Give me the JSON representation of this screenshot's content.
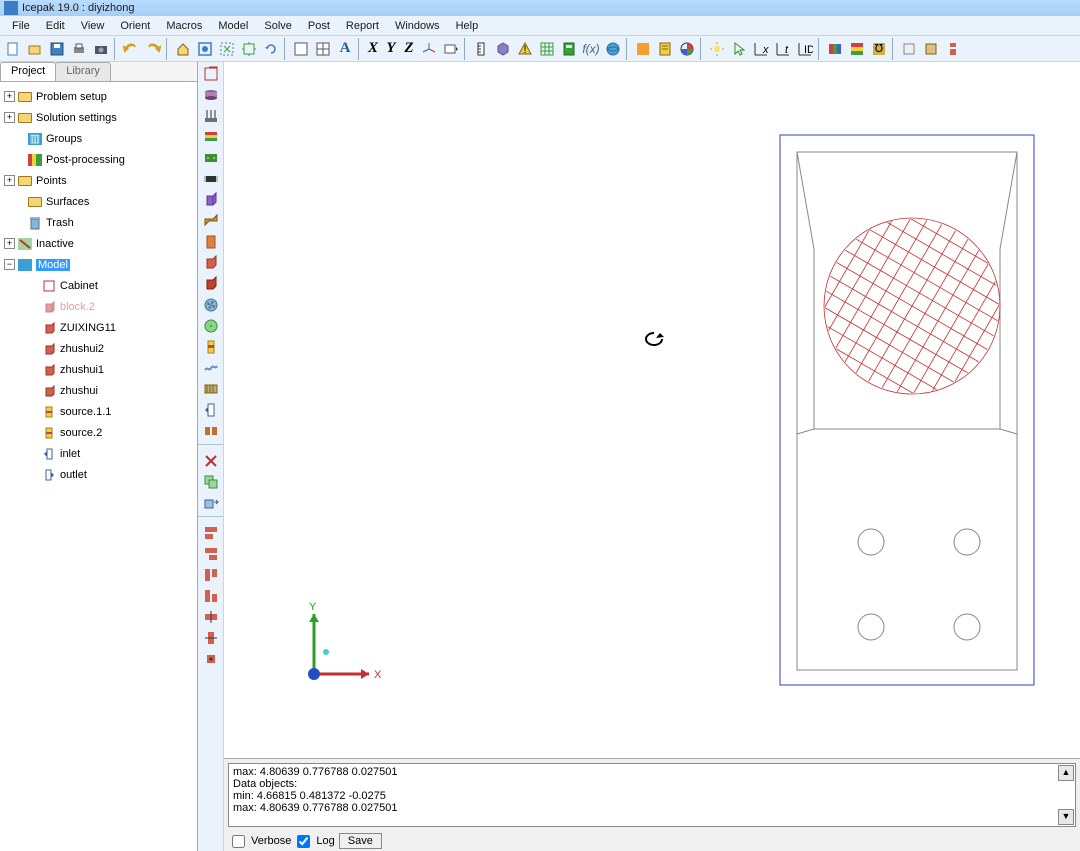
{
  "title": "Icepak 19.0 : diyizhong",
  "menu": [
    "File",
    "Edit",
    "View",
    "Orient",
    "Macros",
    "Model",
    "Solve",
    "Post",
    "Report",
    "Windows",
    "Help"
  ],
  "tabs": {
    "project": "Project",
    "library": "Library"
  },
  "tree": {
    "problem_setup": "Problem setup",
    "solution_settings": "Solution settings",
    "groups": "Groups",
    "post_processing": "Post-processing",
    "points": "Points",
    "surfaces": "Surfaces",
    "trash": "Trash",
    "inactive": "Inactive",
    "model": "Model",
    "cabinet": "Cabinet",
    "block2": "block.2",
    "zuixing11": "ZUIXING11",
    "zhushui2": "zhushui2",
    "zhushui1": "zhushui1",
    "zhushui": "zhushui",
    "source11": "source.1.1",
    "source2": "source.2",
    "inlet": "inlet",
    "outlet": "outlet"
  },
  "axes": {
    "x": "X",
    "y": "Y"
  },
  "tb_axes": {
    "x": "X",
    "y": "Y",
    "z": "Z"
  },
  "messages": {
    "l1": "    max: 4.80639 0.776788 0.027501",
    "l2": "Data objects:",
    "l3": "    min: 4.66815 0.481372 -0.0275",
    "l4": "    max: 4.80639 0.776788 0.027501"
  },
  "options": {
    "verbose": "Verbose",
    "log": "Log",
    "save": "Save"
  }
}
